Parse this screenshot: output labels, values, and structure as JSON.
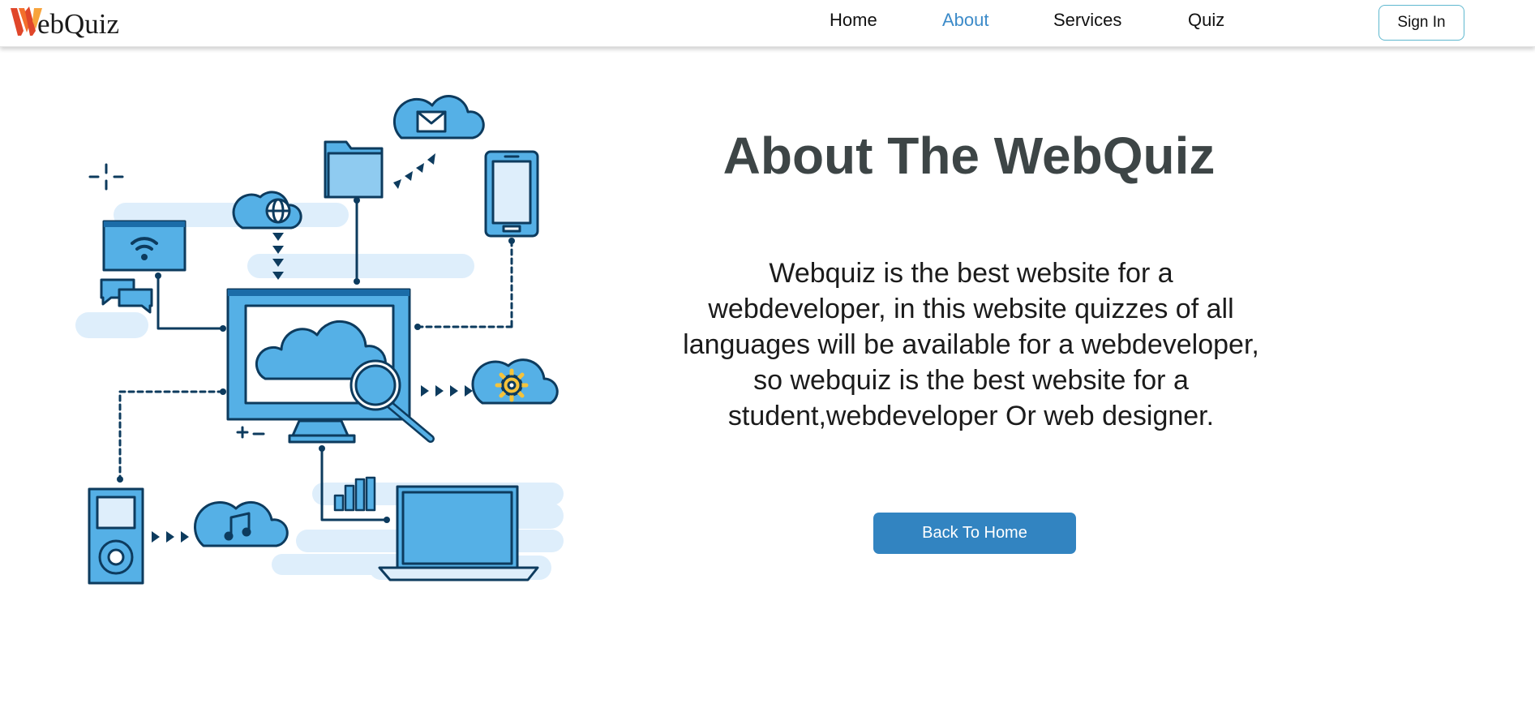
{
  "header": {
    "logo_text": "ebQuiz",
    "logo_letter": "W",
    "nav": [
      "Home",
      "About",
      "Services",
      "Quiz"
    ],
    "active_nav": "About",
    "signin_label": "Sign In"
  },
  "about": {
    "title": "About The WebQuiz",
    "description": "Webquiz is the best website for a webdeveloper, in this website quizzes of all languages will be available for a webdeveloper, so webquiz is the best website for a student,webdeveloper Or web designer.",
    "button_label": "Back To Home"
  },
  "illustration": {
    "subject": "cloud computing network with connected devices",
    "icons": [
      "wifi-icon",
      "chat-icon",
      "globe-cloud-icon",
      "folder-icon",
      "mail-cloud-icon",
      "smartphone-icon",
      "monitor-cloud-search-icon",
      "gear-cloud-icon",
      "music-player-icon",
      "music-cloud-icon",
      "bar-chart-icon",
      "laptop-icon"
    ]
  },
  "colors": {
    "accent": "#3c8bc9",
    "button": "#3284c1",
    "title": "#3d4546",
    "logo_orange": "#f26b2b",
    "icon_blue": "#55b0e6",
    "icon_outline": "#0d3b5e",
    "icon_bg": "#deeefb"
  }
}
